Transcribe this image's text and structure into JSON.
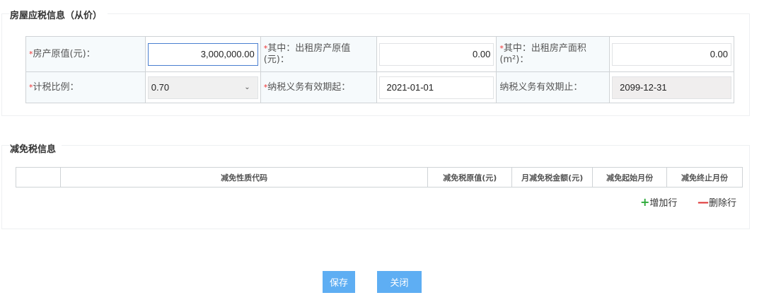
{
  "section1": {
    "title": "房屋应税信息（从价）",
    "original_value_label": "房产原值(元)：",
    "original_value": "3,000,000.00",
    "rent_value_label": "其中：出租房产原值(元)：",
    "rent_value": "0.00",
    "rent_area_label": "其中：出租房产面积(m²)：",
    "rent_area": "0.00",
    "tax_ratio_label": "计税比例：",
    "tax_ratio": "0.70",
    "start_label": "纳税义务有效期起：",
    "start_date": "2021-01-01",
    "end_label": "纳税义务有效期止：",
    "end_date": "2099-12-31"
  },
  "section2": {
    "title": "减免税信息",
    "columns": [
      "",
      "减免性质代码",
      "减免税原值(元)",
      "月减免税金额(元)",
      "减免起始月份",
      "减免终止月份"
    ],
    "add_row": "增加行",
    "delete_row": "删除行"
  },
  "buttons": {
    "save": "保存",
    "close": "关闭"
  },
  "colors": {
    "accent": "#5eaef3",
    "required": "#ee3333",
    "add": "#2eaa3a",
    "delete": "#dd3333"
  }
}
